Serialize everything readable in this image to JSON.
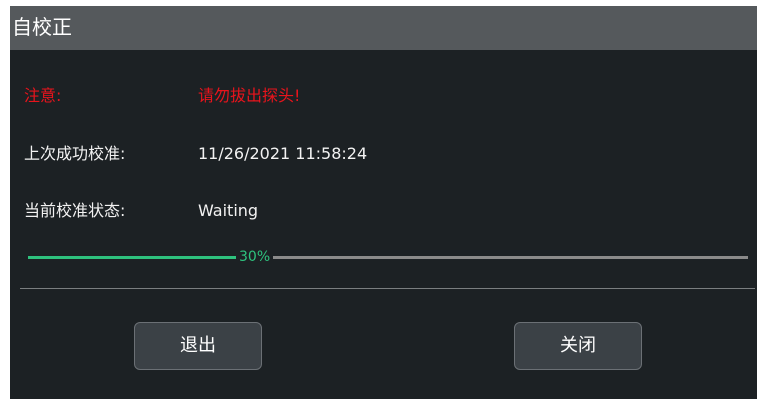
{
  "dialog": {
    "title": "自校正"
  },
  "notice": {
    "label": "注意:",
    "message": "请勿拔出探头!"
  },
  "last_calibration": {
    "label": "上次成功校准:",
    "value": "11/26/2021 11:58:24"
  },
  "status": {
    "label": "当前校准状态:",
    "value": "Waiting"
  },
  "progress": {
    "percent": 30,
    "text": "30%"
  },
  "buttons": {
    "exit": "退出",
    "close": "关闭"
  },
  "colors": {
    "background": "#1c2124",
    "titlebar": "#55595c",
    "warning": "#e8141c",
    "progress_done": "#2ec27e",
    "progress_remaining": "#8a8a8a",
    "button": "#3b4146"
  }
}
